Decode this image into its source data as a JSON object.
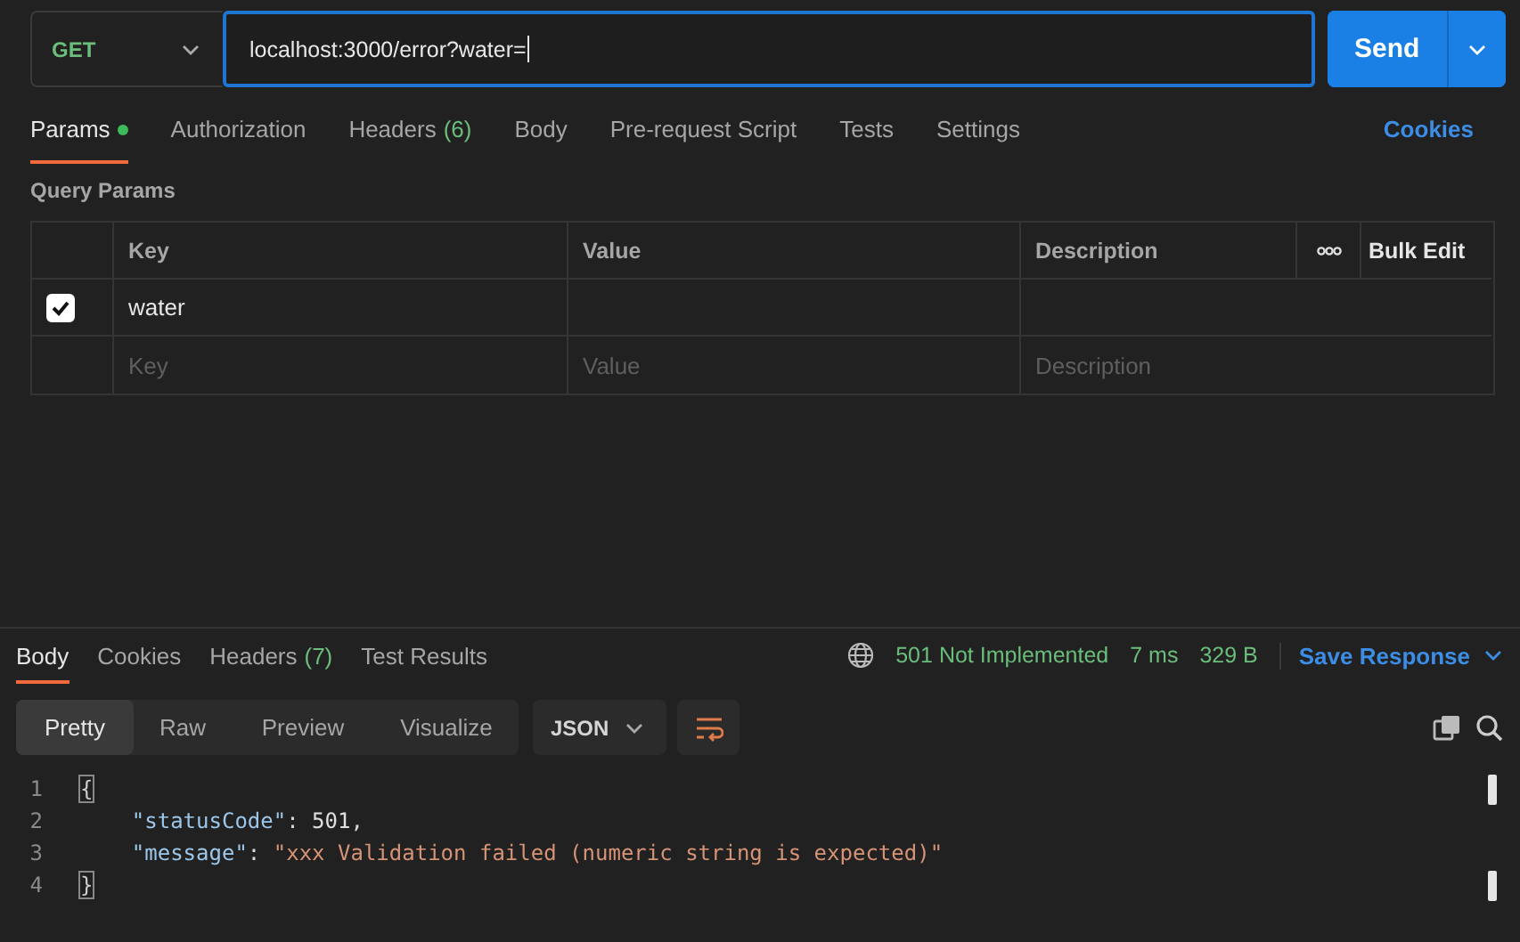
{
  "request": {
    "method": "GET",
    "url": "localhost:3000/error?water=",
    "send_label": "Send"
  },
  "request_tabs": [
    {
      "label": "Params",
      "selected": true,
      "indicator": true
    },
    {
      "label": "Authorization",
      "selected": false
    },
    {
      "label": "Headers",
      "count": "(6)",
      "selected": false
    },
    {
      "label": "Body",
      "selected": false
    },
    {
      "label": "Pre-request Script",
      "selected": false
    },
    {
      "label": "Tests",
      "selected": false
    },
    {
      "label": "Settings",
      "selected": false
    }
  ],
  "cookies_link": "Cookies",
  "query_params": {
    "title": "Query Params",
    "columns": [
      "Key",
      "Value",
      "Description"
    ],
    "bulk_edit": "Bulk Edit",
    "rows": [
      {
        "checked": true,
        "key": "water"
      }
    ],
    "new_row": {
      "key_placeholder": "Key",
      "value_placeholder": "Value",
      "description_placeholder": "Description"
    }
  },
  "response": {
    "tabs": [
      {
        "label": "Body",
        "selected": true
      },
      {
        "label": "Cookies",
        "selected": false
      },
      {
        "label": "Headers",
        "count": "(7)",
        "selected": false
      },
      {
        "label": "Test Results",
        "selected": false
      }
    ],
    "status": "501 Not Implemented",
    "time": "7 ms",
    "size": "329 B",
    "save_label": "Save Response",
    "views": [
      {
        "label": "Pretty",
        "selected": true
      },
      {
        "label": "Raw",
        "selected": false
      },
      {
        "label": "Preview",
        "selected": false
      },
      {
        "label": "Visualize",
        "selected": false
      }
    ],
    "format": "JSON",
    "code": [
      {
        "number": "1",
        "tokens": [
          {
            "kind": "brace",
            "text": "{"
          }
        ]
      },
      {
        "number": "2",
        "tokens": [
          {
            "kind": "key",
            "text": "\"statusCode\""
          },
          {
            "kind": "punct",
            "text": ": "
          },
          {
            "kind": "number",
            "text": "501"
          },
          {
            "kind": "punct",
            "text": ","
          }
        ]
      },
      {
        "number": "3",
        "tokens": [
          {
            "kind": "key",
            "text": "\"message\""
          },
          {
            "kind": "punct",
            "text": ": "
          },
          {
            "kind": "string",
            "text": "\"xxx Validation failed (numeric string is expected)\""
          }
        ]
      },
      {
        "number": "4",
        "tokens": [
          {
            "kind": "brace",
            "text": "}"
          }
        ]
      }
    ]
  }
}
